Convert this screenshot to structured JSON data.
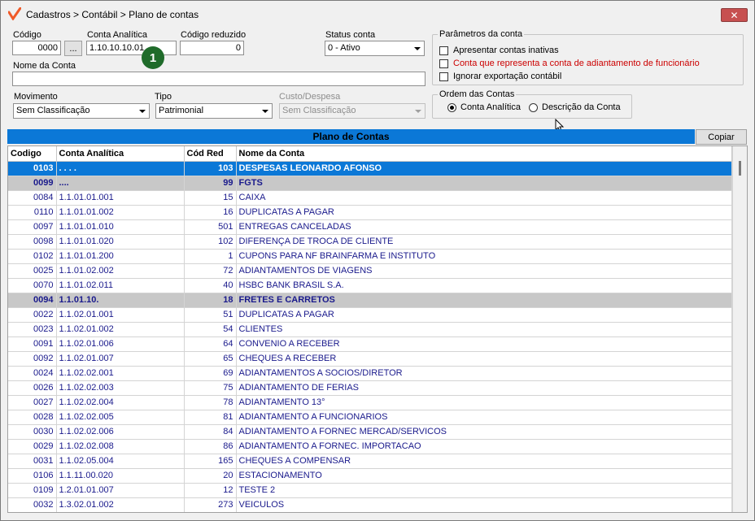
{
  "window": {
    "title": "Cadastros > Contábil > Plano de contas",
    "close_label": "✕"
  },
  "form": {
    "codigo_label": "Código",
    "codigo_value": "0000",
    "browse_label": "...",
    "conta_analitica_label": "Conta Analítica",
    "conta_analitica_value": "1.10.10.10.01",
    "codigo_reduzido_label": "Código reduzido",
    "codigo_reduzido_value": "0",
    "status_label": "Status conta",
    "status_value": "0 - Ativo",
    "nome_label": "Nome da Conta",
    "nome_value": "",
    "movimento_label": "Movimento",
    "movimento_value": "Sem Classificação",
    "tipo_label": "Tipo",
    "tipo_value": "Patrimonial",
    "custo_label": "Custo/Despesa",
    "custo_value": "Sem Classificação",
    "badge": "1"
  },
  "parametros": {
    "title": "Parâmetros da conta",
    "opt1": "Apresentar contas inativas",
    "opt2": "Conta que representa a conta de adiantamento de funcionário",
    "opt3": "Ignorar exportação contábil"
  },
  "ordem": {
    "title": "Ordem das Contas",
    "opt1": "Conta Analítica",
    "opt2": "Descrição da Conta",
    "selected": "opt1"
  },
  "plano": {
    "title": "Plano de Contas",
    "copy_label": "Copiar"
  },
  "table": {
    "columns": [
      "Codigo",
      "Conta Analítica",
      "Cód Red",
      "Nome da Conta"
    ],
    "rows": [
      {
        "codigo": "0103",
        "conta": ". . . .",
        "red": "103",
        "nome": "DESPESAS LEONARDO AFONSO",
        "type": "selected"
      },
      {
        "codigo": "0099",
        "conta": "....",
        "red": "99",
        "nome": "FGTS",
        "type": "group"
      },
      {
        "codigo": "0084",
        "conta": "1.1.01.01.001",
        "red": "15",
        "nome": "CAIXA",
        "type": "normal"
      },
      {
        "codigo": "0110",
        "conta": "1.1.01.01.002",
        "red": "16",
        "nome": "DUPLICATAS A PAGAR",
        "type": "normal"
      },
      {
        "codigo": "0097",
        "conta": "1.1.01.01.010",
        "red": "501",
        "nome": "ENTREGAS CANCELADAS",
        "type": "normal"
      },
      {
        "codigo": "0098",
        "conta": "1.1.01.01.020",
        "red": "102",
        "nome": "DIFERENÇA DE TROCA DE CLIENTE",
        "type": "normal"
      },
      {
        "codigo": "0102",
        "conta": "1.1.01.01.200",
        "red": "1",
        "nome": "CUPONS PARA NF BRAINFARMA E INSTITUTO",
        "type": "normal"
      },
      {
        "codigo": "0025",
        "conta": "1.1.01.02.002",
        "red": "72",
        "nome": "ADIANTAMENTOS DE VIAGENS",
        "type": "normal"
      },
      {
        "codigo": "0070",
        "conta": "1.1.01.02.011",
        "red": "40",
        "nome": "HSBC BANK BRASIL S.A.",
        "type": "normal"
      },
      {
        "codigo": "0094",
        "conta": "1.1.01.10.",
        "red": "18",
        "nome": "FRETES E CARRETOS",
        "type": "group"
      },
      {
        "codigo": "0022",
        "conta": "1.1.02.01.001",
        "red": "51",
        "nome": "DUPLICATAS A PAGAR",
        "type": "normal"
      },
      {
        "codigo": "0023",
        "conta": "1.1.02.01.002",
        "red": "54",
        "nome": "CLIENTES",
        "type": "normal"
      },
      {
        "codigo": "0091",
        "conta": "1.1.02.01.006",
        "red": "64",
        "nome": "CONVENIO A RECEBER",
        "type": "normal"
      },
      {
        "codigo": "0092",
        "conta": "1.1.02.01.007",
        "red": "65",
        "nome": "CHEQUES A RECEBER",
        "type": "normal"
      },
      {
        "codigo": "0024",
        "conta": "1.1.02.02.001",
        "red": "69",
        "nome": "ADIANTAMENTOS A SOCIOS/DIRETOR",
        "type": "normal"
      },
      {
        "codigo": "0026",
        "conta": "1.1.02.02.003",
        "red": "75",
        "nome": "ADIANTAMENTO DE FERIAS",
        "type": "normal"
      },
      {
        "codigo": "0027",
        "conta": "1.1.02.02.004",
        "red": "78",
        "nome": "ADIANTAMENTO 13°",
        "type": "normal"
      },
      {
        "codigo": "0028",
        "conta": "1.1.02.02.005",
        "red": "81",
        "nome": "ADIANTAMENTO A FUNCIONARIOS",
        "type": "normal"
      },
      {
        "codigo": "0030",
        "conta": "1.1.02.02.006",
        "red": "84",
        "nome": "ADIANTAMENTO A FORNEC MERCAD/SERVICOS",
        "type": "normal"
      },
      {
        "codigo": "0029",
        "conta": "1.1.02.02.008",
        "red": "86",
        "nome": "ADIANTAMENTO A FORNEC. IMPORTACAO",
        "type": "normal"
      },
      {
        "codigo": "0031",
        "conta": "1.1.02.05.004",
        "red": "165",
        "nome": "CHEQUES A COMPENSAR",
        "type": "normal"
      },
      {
        "codigo": "0106",
        "conta": "1.1.11.00.020",
        "red": "20",
        "nome": "ESTACIONAMENTO",
        "type": "normal"
      },
      {
        "codigo": "0109",
        "conta": "1.2.01.01.007",
        "red": "12",
        "nome": "TESTE 2",
        "type": "normal"
      },
      {
        "codigo": "0032",
        "conta": "1.3.02.01.002",
        "red": "273",
        "nome": "VEICULOS",
        "type": "normal"
      }
    ]
  },
  "colors": {
    "accent": "#0b78d7",
    "group_row": "#c8c8c8",
    "badge": "#1f6b2a",
    "warning_text": "#cc0000"
  }
}
